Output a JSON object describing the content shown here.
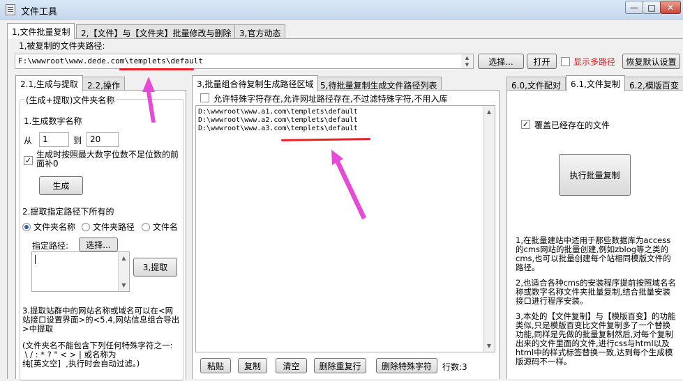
{
  "window": {
    "title": "文件工具",
    "min_label": "—",
    "max_label": "□",
    "close_label": "✕"
  },
  "top_tabs": [
    {
      "label": "1,文件批量复制"
    },
    {
      "label": "2,【文件】与【文件夹】批量修改与删除"
    },
    {
      "label": "3,官方动态"
    }
  ],
  "source": {
    "label": "1,被复制的文件夹路径:",
    "path": "F:\\wwwroot\\www.dede.com\\templets\\default",
    "select_button": "选择...",
    "open_button": "打开",
    "show_multi_label": "显示多路径",
    "restore_button": "恢复默认设置"
  },
  "left": {
    "tabs": [
      {
        "label": "2.1,生成与提取"
      },
      {
        "label": "2.2,操作"
      }
    ],
    "group_title": "(生成+提取)文件夹名称",
    "gen_title": "1.生成数字名称",
    "from_label": "从",
    "from_value": "1",
    "to_label": "到",
    "to_value": "20",
    "pad_label": "生成时按照最大数字位数不足位数的前面补0",
    "generate_button": "生成",
    "extract_title": "2.提取指定路径下所有的",
    "radios": [
      {
        "label": "文件夹名称",
        "checked": true
      },
      {
        "label": "文件夹路径",
        "checked": false
      },
      {
        "label": "文件名",
        "checked": false
      }
    ],
    "path_label": "指定路径:",
    "path_select_button": "选择...",
    "extract_button": "3,提取",
    "note1": "3.提取站群中的网站名称或域名可以在<网站接口设置界面>的<5.4,网站信息组合导出>中提取",
    "note2": "(文件夹名不能包含下列任何特殊字符之一:\n \\ / : * ? \" < > | 或名称为\n纯[英文空]  ,执行时会自动过滤。)"
  },
  "middle": {
    "tabs": [
      {
        "label": "3,批量组合待复制生成路径区域"
      },
      {
        "label": "5,待批量复制生成文件路径列表"
      }
    ],
    "allow_special_label": "允许特殊字符存在,允许网址路径存在,不过滤特殊字符,不用入库",
    "paths": [
      "D:\\wwwroot\\www.a1.com\\templets\\default",
      "D:\\wwwroot\\www.a2.com\\templets\\default",
      "D:\\wwwroot\\www.a3.com\\templets\\default"
    ],
    "buttons": {
      "paste": "粘贴",
      "copy": "复制",
      "clear": "清空",
      "dedupe": "删除重复行",
      "remove_special": "删除特殊字符"
    },
    "line_count": "行数:3"
  },
  "right": {
    "tabs": [
      {
        "label": "6.0,文件配对"
      },
      {
        "label": "6.1,文件复制"
      },
      {
        "label": "6.2,模版百变"
      }
    ],
    "overwrite_label": "覆盖已经存在的文件",
    "execute_button": "执行批量复制",
    "desc1": "1,在批量建站中适用于那些数据库为access的cms网站的批量创建,例如zblog等之类的cms,也可以批量创建每个站相同模版文件的路径。",
    "desc2": "2,也适合各种cms的安装程序提前按照域名名称或数字名称文件夹批量复制,结合批量安装接口进行程序安装。",
    "desc3": "3,本处的【文件复制】与【模版百变】的功能类似,只是模版百变比文件复制多了一个替换功能,同样是先做的批量复制然后,对每个复制出来的文件里面的文件,进行css与html以及html中的样式标签替换一致,达到每个生成模版源码不一样。"
  },
  "colors": {
    "annotation_red": "#e8202a",
    "annotation_arrow": "#e84ad8"
  }
}
